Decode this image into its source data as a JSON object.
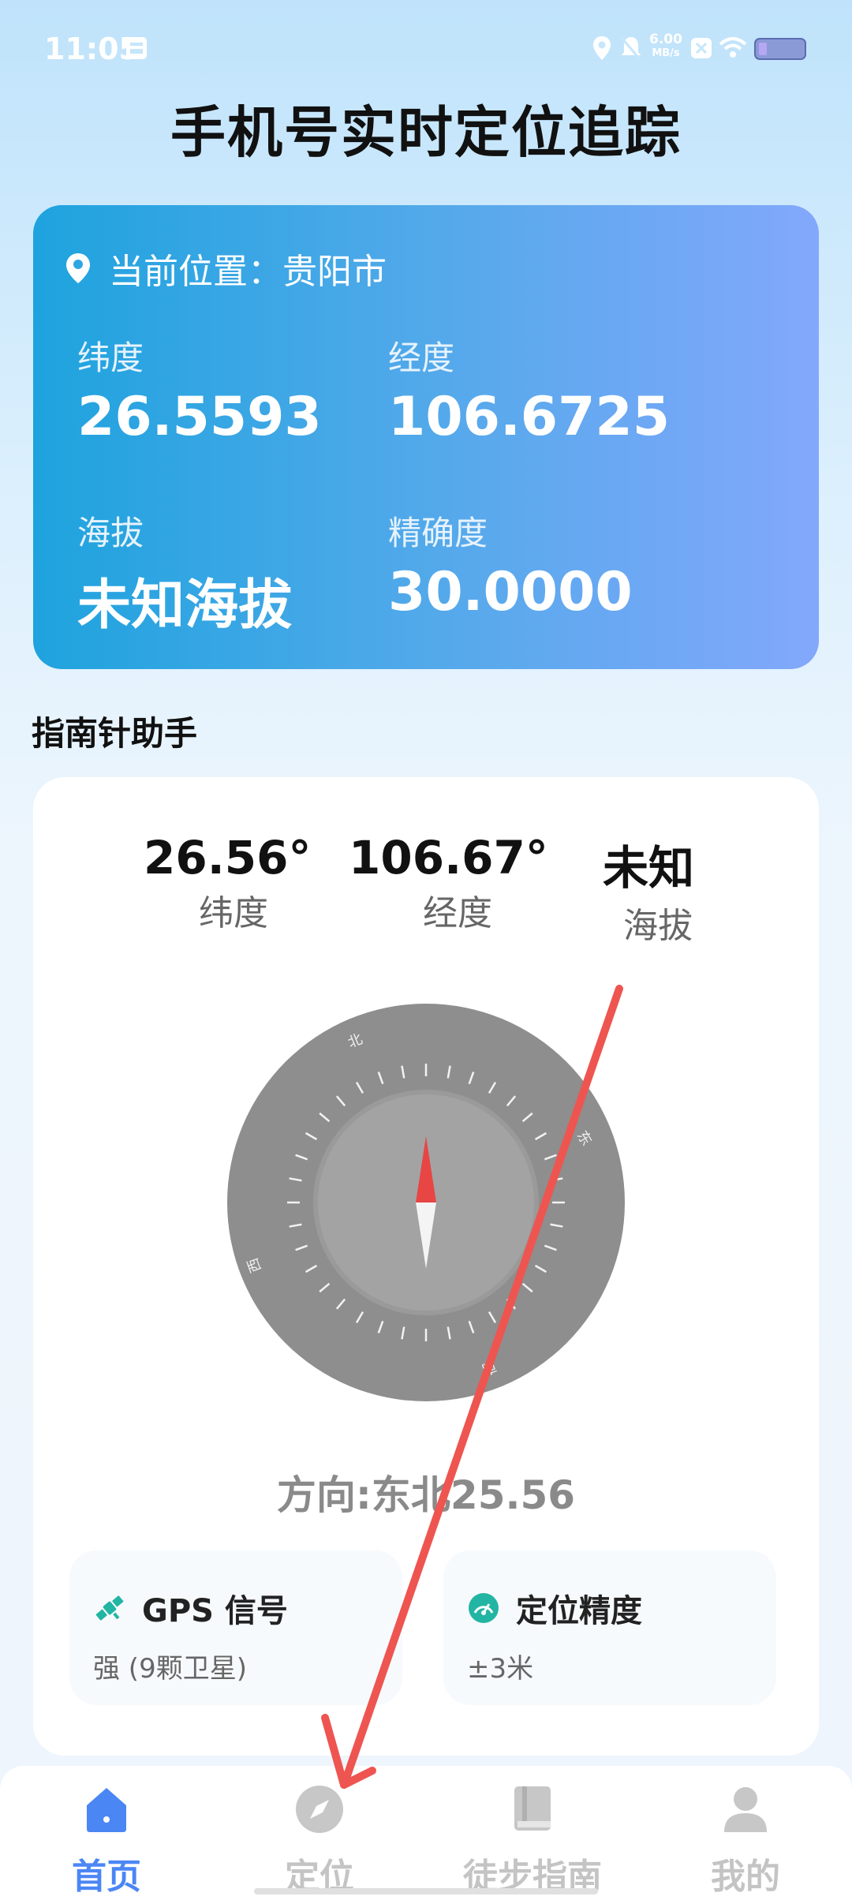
{
  "status_bar": {
    "time": "11:05",
    "net_speed_value": "6.00",
    "net_speed_unit": "MB/s",
    "icons": [
      "notification-icon",
      "location-icon",
      "mute-icon",
      "speed-icon",
      "close-box-icon",
      "wifi-icon",
      "battery-icon"
    ]
  },
  "header": {
    "title": "手机号实时定位追踪"
  },
  "location_card": {
    "current_location": "当前位置：贵阳市",
    "latitude_label": "纬度",
    "latitude_value": "26.5593",
    "longitude_label": "经度",
    "longitude_value": "106.6725",
    "altitude_label": "海拔",
    "altitude_value": "未知海拔",
    "accuracy_label": "精确度",
    "accuracy_value": "30.0000"
  },
  "compass_section": {
    "title": "指南针助手",
    "stats": [
      {
        "value": "26.56°",
        "label": "纬度"
      },
      {
        "value": "106.67°",
        "label": "经度"
      },
      {
        "value": "未知",
        "label": "海拔"
      }
    ],
    "dial": {
      "north": "北",
      "east": "东",
      "south": "南",
      "west": "西",
      "heading_deg": 0
    },
    "direction_text": "方向:东北25.56",
    "gps": {
      "title": "GPS 信号",
      "value": "强 (9颗卫星)"
    },
    "precision": {
      "title": "定位精度",
      "value": "±3米"
    }
  },
  "bottom_nav": {
    "items": [
      {
        "label": "首页",
        "icon": "home-icon",
        "active": true
      },
      {
        "label": "定位",
        "icon": "compass-icon",
        "active": false
      },
      {
        "label": "徒步指南",
        "icon": "book-icon",
        "active": false
      },
      {
        "label": "我的",
        "icon": "user-icon",
        "active": false
      }
    ]
  },
  "colors": {
    "accent": "#4b86f5",
    "annotation_arrow": "#ee5550",
    "card_gradient_start": "#1ea3de",
    "card_gradient_end": "#83a8fc",
    "gps_icon": "#22b5a3",
    "precision_icon": "#22b5a3"
  }
}
